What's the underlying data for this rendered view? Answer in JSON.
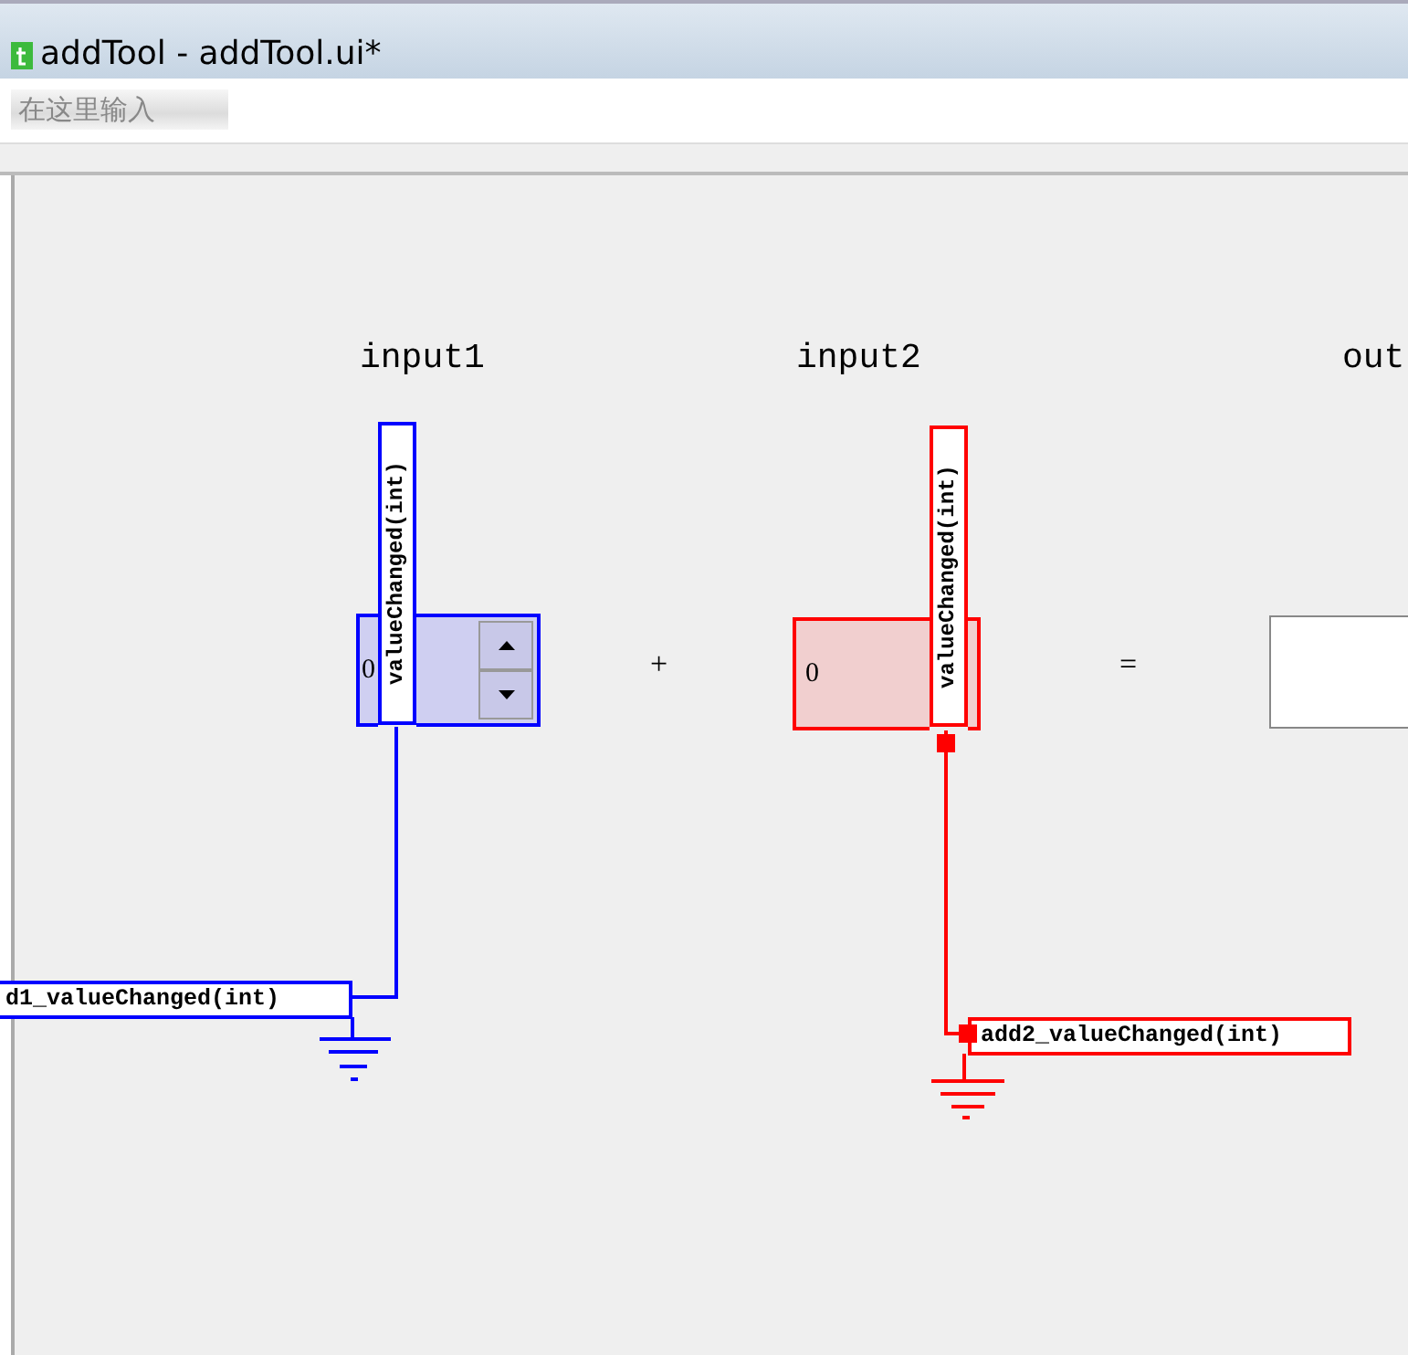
{
  "window": {
    "title": "addTool - addTool.ui*"
  },
  "search": {
    "placeholder": "在这里输入"
  },
  "form": {
    "labels": [
      "input1",
      "input2",
      "out"
    ],
    "operators": [
      "+",
      "="
    ],
    "spinboxes": [
      {
        "value": "0"
      },
      {
        "value": "0"
      }
    ],
    "connections": [
      {
        "signal": "valueChanged(int)",
        "slot": "d1_valueChanged(int)",
        "color": "#0000ff"
      },
      {
        "signal": "valueChanged(int)",
        "slot": "add2_valueChanged(int)",
        "color": "#ff0000"
      }
    ]
  }
}
